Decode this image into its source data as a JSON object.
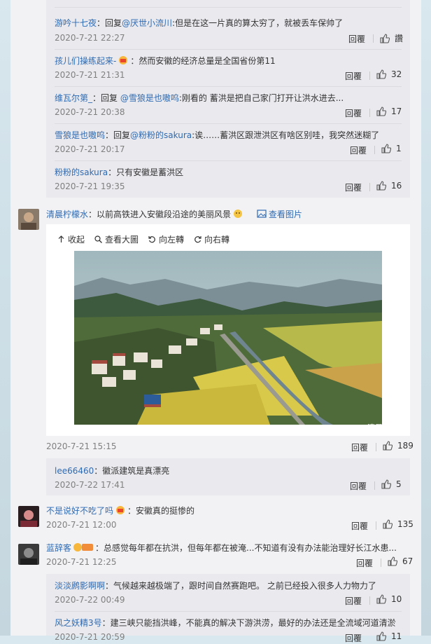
{
  "threads": {
    "top_replies": [
      {
        "user": "游吟十七夜",
        "prefix": "：回复",
        "target": "@厌世小流川",
        "text": ":但是在这一片真的算太穷了，就被丢车保帅了",
        "time": "2020-7-21 22:27",
        "reply": "回覆",
        "likes": "讚"
      },
      {
        "user": "孩儿们操练起来-",
        "prefix": "",
        "target": "",
        "text": "：然而安徽的经济总量是全国省份第11",
        "time": "2020-7-21 21:31",
        "reply": "回覆",
        "likes": "32"
      },
      {
        "user": "维瓦尔第_",
        "prefix": "：回复 ",
        "target": "@雪狼是也嗷呜",
        "text": ":刚看的 蓄洪是把自己家门打开让洪水进去...",
        "time": "2020-7-21 20:38",
        "reply": "回覆",
        "likes": "17"
      },
      {
        "user": "雪狼是也嗷呜",
        "prefix": "：回复",
        "target": "@粉粉的sakura",
        "text": ":诶……蓄洪区跟泄洪区有啥区别哇，我突然迷糊了",
        "time": "2020-7-21 20:17",
        "reply": "回覆",
        "likes": "1"
      },
      {
        "user": "粉粉的sakura",
        "prefix": "",
        "target": "",
        "text": "：只有安徽是蓄洪区",
        "time": "2020-7-21 19:35",
        "reply": "回覆",
        "likes": "16"
      }
    ],
    "photo_post": {
      "user": "清晨柠檬水",
      "text": "：以前高铁进入安徽段沿途的美丽风景",
      "view_image": "查看图片",
      "toolbar": [
        "收起",
        "查看大圖",
        "向左轉",
        "向右轉"
      ],
      "watermark": "@清晨柠檬水",
      "time": "2020-7-21 15:15",
      "reply": "回覆",
      "likes": "189",
      "sub_reply": {
        "user": "lee66460",
        "text": "：徽派建筑是真漂亮",
        "time": "2020-7-22 17:41",
        "reply": "回覆",
        "likes": "5"
      }
    },
    "post2": {
      "user": "不是说好不吃了吗",
      "text": "：安徽真的挺惨的",
      "time": "2020-7-21 12:00",
      "reply": "回覆",
      "likes": "135"
    },
    "post3": {
      "user": "蓝辞客",
      "text": "：总感觉每年都在抗洪，但每年都在被淹...不知道有没有办法能治理好长江水患...",
      "time": "2020-7-21 12:25",
      "reply": "回覆",
      "likes": "67",
      "sub_replies": [
        {
          "user": "淡淡䴘影啊啊",
          "text": "：气候越来越极端了，跟时间自然赛跑吧。 之前已经投入很多人力物力了",
          "time": "2020-7-22 00:49",
          "reply": "回覆",
          "likes": "10"
        },
        {
          "user": "风之妖精3号",
          "text": "：建三峡只能挡洪峰，不能真的解决下游洪涝，最好的办法还是全流域河道清淤",
          "time": "2020-7-21 20:59",
          "reply": "回覆",
          "likes": "11"
        }
      ]
    }
  }
}
